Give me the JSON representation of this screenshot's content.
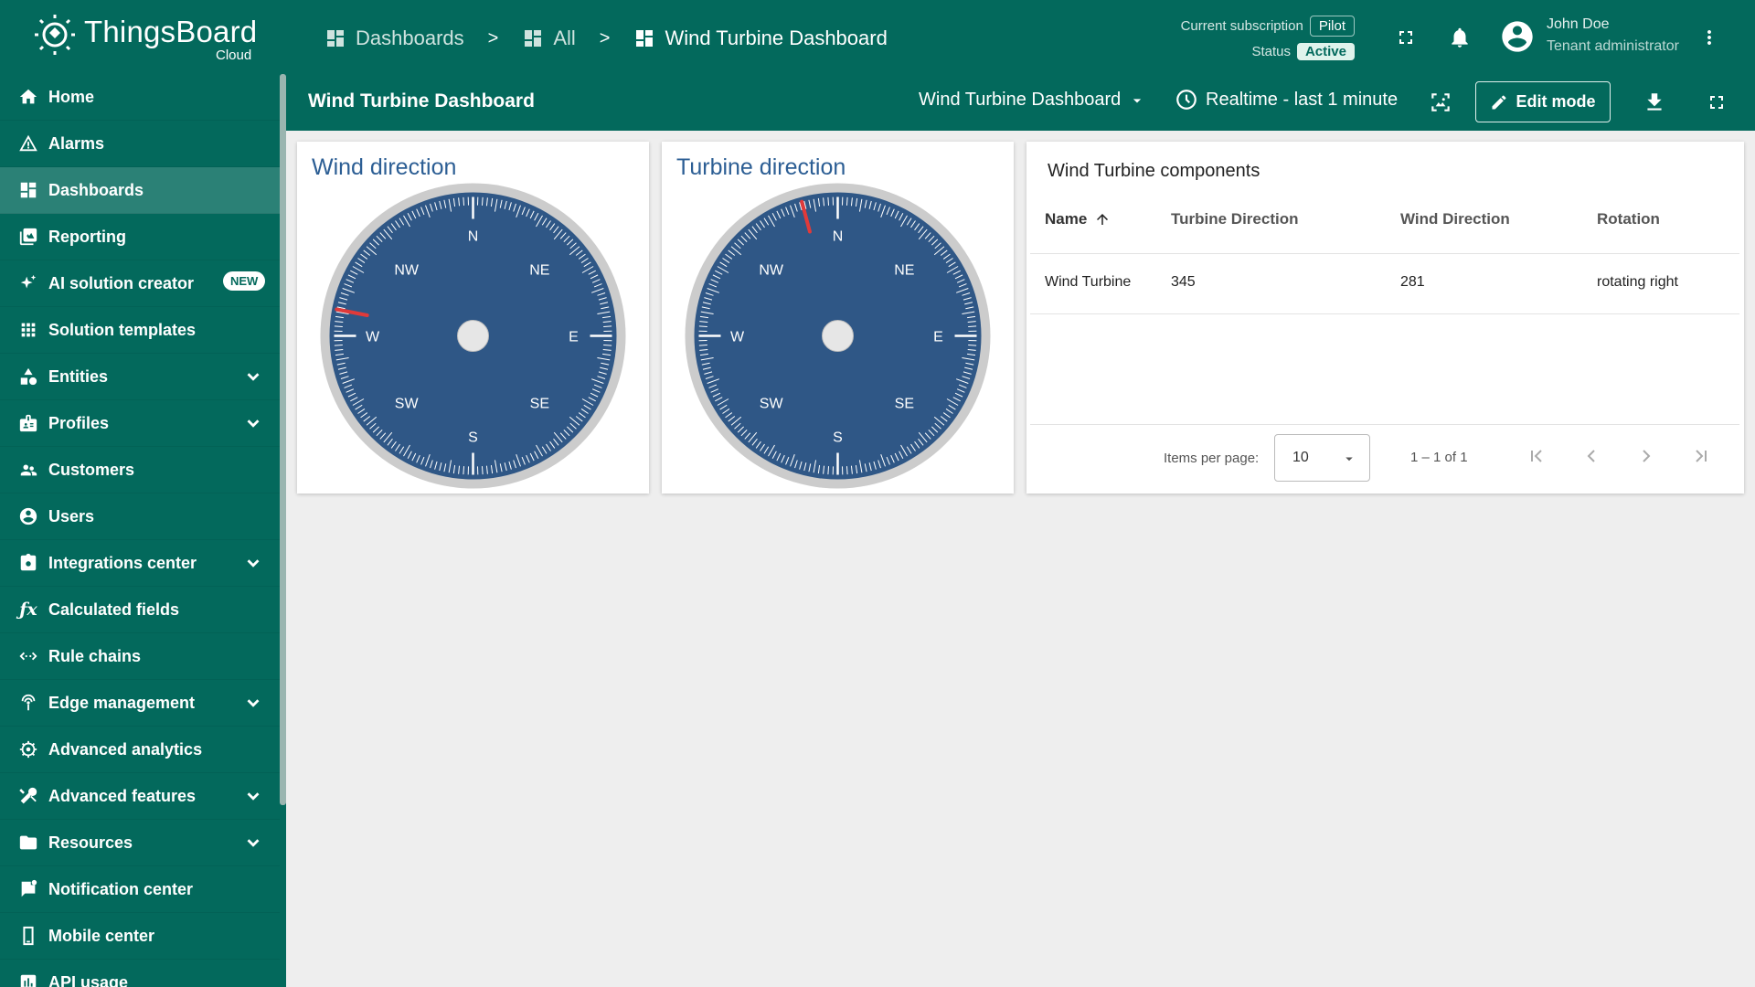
{
  "brand": {
    "name": "ThingsBoard",
    "edition": "Cloud"
  },
  "breadcrumb": [
    {
      "label": "Dashboards",
      "icon": "dashboard-icon"
    },
    {
      "label": "All",
      "icon": "dashboard-icon"
    },
    {
      "label": "Wind Turbine Dashboard",
      "icon": "dashboard-icon"
    }
  ],
  "breadcrumb_separator": ">",
  "subscription": {
    "label": "Current subscription",
    "plan": "Pilot",
    "status_label": "Status",
    "status": "Active"
  },
  "user": {
    "name": "John Doe",
    "role": "Tenant administrator"
  },
  "sidebar": {
    "items": [
      {
        "label": "Home",
        "icon": "home-icon"
      },
      {
        "label": "Alarms",
        "icon": "alarm-icon"
      },
      {
        "label": "Dashboards",
        "icon": "dashboard-icon",
        "active": true
      },
      {
        "label": "Reporting",
        "icon": "reporting-icon"
      },
      {
        "label": "AI solution creator",
        "icon": "sparkle-icon",
        "badge": "NEW"
      },
      {
        "label": "Solution templates",
        "icon": "grid-icon"
      },
      {
        "label": "Entities",
        "icon": "entities-icon",
        "expandable": true
      },
      {
        "label": "Profiles",
        "icon": "profiles-icon",
        "expandable": true
      },
      {
        "label": "Customers",
        "icon": "customers-icon"
      },
      {
        "label": "Users",
        "icon": "user-icon"
      },
      {
        "label": "Integrations center",
        "icon": "integrations-icon",
        "expandable": true
      },
      {
        "label": "Calculated fields",
        "icon": "function-icon"
      },
      {
        "label": "Rule chains",
        "icon": "rule-chain-icon"
      },
      {
        "label": "Edge management",
        "icon": "edge-icon",
        "expandable": true
      },
      {
        "label": "Advanced analytics",
        "icon": "analytics-icon"
      },
      {
        "label": "Advanced features",
        "icon": "tools-icon",
        "expandable": true
      },
      {
        "label": "Resources",
        "icon": "folder-icon",
        "expandable": true
      },
      {
        "label": "Notification center",
        "icon": "notification-icon"
      },
      {
        "label": "Mobile center",
        "icon": "mobile-icon"
      },
      {
        "label": "API usage",
        "icon": "api-usage-icon"
      }
    ]
  },
  "dashboard": {
    "title": "Wind Turbine Dashboard",
    "state_select": "Wind Turbine Dashboard",
    "timewindow": "Realtime - last 1 minute",
    "edit_label": "Edit mode"
  },
  "widgets": {
    "wind": {
      "title": "Wind direction",
      "value": 281
    },
    "turbine": {
      "title": "Turbine direction",
      "value": 345
    },
    "compass_labels": [
      "N",
      "NE",
      "E",
      "SE",
      "S",
      "SW",
      "W",
      "NW"
    ],
    "colors": {
      "dial": "#2f5786",
      "rim": "#cccccc",
      "needle": "#e03a3a",
      "center": "#e6e6e6"
    }
  },
  "table": {
    "title": "Wind Turbine components",
    "columns": [
      "Name",
      "Turbine Direction",
      "Wind Direction",
      "Rotation"
    ],
    "rows": [
      [
        "Wind Turbine",
        "345",
        "281",
        "rotating right"
      ]
    ],
    "items_per_page_label": "Items per page:",
    "items_per_page": "10",
    "range": "1 – 1 of 1"
  },
  "colors": {
    "primary": "#03695c",
    "active_item": "#2b8176",
    "title_blue": "#2c5e94"
  }
}
